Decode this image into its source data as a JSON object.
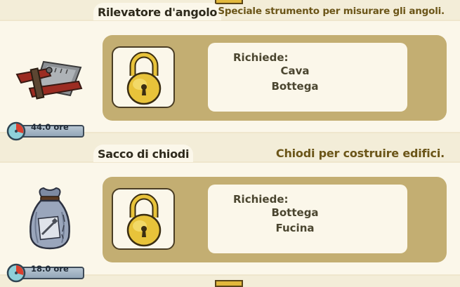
{
  "items": [
    {
      "name": "Rilevatore d'angolo",
      "description": "Speciale strumento per misurare gli angoli.",
      "icon": "protractor-tool-icon",
      "requires_label": "Richiede:",
      "requirements": [
        "Cava",
        "Bottega"
      ],
      "time": "44.0 ore",
      "locked": true
    },
    {
      "name": "Sacco di chiodi",
      "description": "Chiodi per costruire edifici.",
      "icon": "nail-sack-icon",
      "requires_label": "Richiede:",
      "requirements": [
        "Bottega",
        "Fucina"
      ],
      "time": "18.0 ore",
      "locked": true
    }
  ],
  "colors": {
    "panel_tan": "#c3ae72",
    "card_cream": "#fbf7ea",
    "lock_gold": "#e8c33a",
    "desc_brown": "#6b5518"
  }
}
